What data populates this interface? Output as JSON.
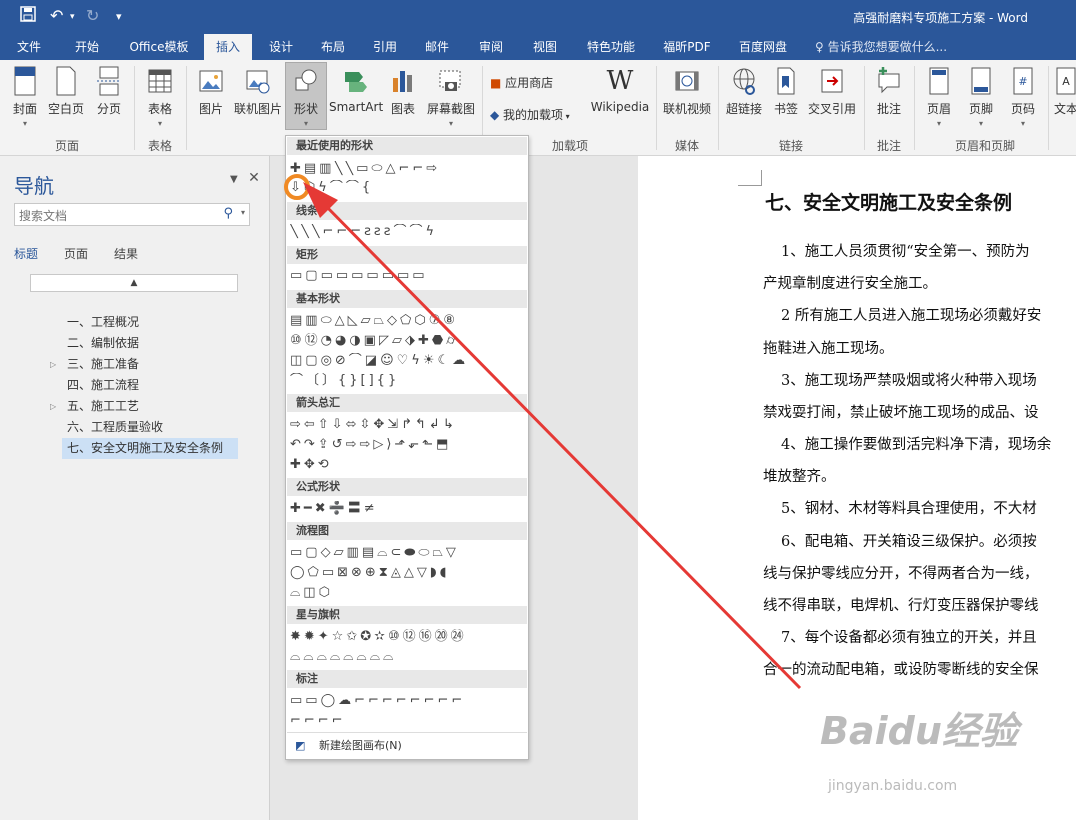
{
  "quick_access": {
    "save_icon": "save-icon",
    "undo_icon": "undo-icon",
    "redo_icon": "redo-icon",
    "customize_icon": "customize-icon"
  },
  "window": {
    "title": "高强耐磨料专项施工方案 - Word"
  },
  "tabs": [
    "文件",
    "开始",
    "Office模板",
    "插入",
    "设计",
    "布局",
    "引用",
    "邮件",
    "审阅",
    "视图",
    "特色功能",
    "福昕PDF",
    "百度网盘"
  ],
  "tell_me": "告诉我您想要做什么...",
  "ribbon": {
    "pages": {
      "cover": "封面",
      "blank": "空白页",
      "break": "分页",
      "group": "页面"
    },
    "tables": {
      "table": "表格",
      "group": "表格"
    },
    "illustrations": {
      "picture": "图片",
      "online_picture": "联机图片",
      "shapes": "形状",
      "smartart": "SmartArt",
      "chart": "图表",
      "screenshot": "屏幕截图"
    },
    "addins": {
      "store": "应用商店",
      "my_addins": "我的加载项",
      "wikipedia": "Wikipedia",
      "group": "加载项"
    },
    "media": {
      "online_video": "联机视频",
      "group": "媒体"
    },
    "links": {
      "hyperlink": "超链接",
      "bookmark": "书签",
      "cross_ref": "交叉引用",
      "group": "链接"
    },
    "comments": {
      "comment": "批注",
      "group": "批注"
    },
    "header_footer": {
      "header": "页眉",
      "footer": "页脚",
      "page_number": "页码",
      "group": "页眉和页脚"
    },
    "text": {
      "textbox": "文本"
    }
  },
  "nav": {
    "title": "导航",
    "search_placeholder": "搜索文档",
    "tabs": [
      "标题",
      "页面",
      "结果"
    ],
    "items": [
      "一、工程概况",
      "二、编制依据",
      "三、施工准备",
      "四、施工流程",
      "五、施工工艺",
      "六、工程质量验收",
      "七、安全文明施工及安全条例"
    ]
  },
  "gallery": {
    "sections": [
      "最近使用的形状",
      "线条",
      "矩形",
      "基本形状",
      "箭头总汇",
      "公式形状",
      "流程图",
      "星与旗帜",
      "标注"
    ],
    "recent_row1": "✚▤▥╲╲▭⬭△⌐⌐⇨",
    "recent_row2": "⇩⬡ϟ⌒⌒{",
    "lines_row": "╲╲╲⌐⌐⌐ƨƨƨ⌒⌒ϟ",
    "rect_row": "▭▢▭▭▭▭▭▭▭",
    "basic_rows": [
      "▤▥⬭△◺▱⏢◇⬠⬡⑦⑧",
      "⑩⑫◔◕◑▣◸▱⬗✚⬣⌭",
      "◫▢◎⊘⌒◪☺♡ϟ☀☾☁",
      "⌒〔〕{}[]{}"
    ],
    "arrow_rows": [
      "⇨⇦⇧⇩⬄⇳✥⇲↱↰↲↳",
      "↶↷⇪↺⇨⇨▷⟩⬏⬐⬑⬒",
      "✚✥⟲"
    ],
    "equation_row": "✚━✖➗〓≠",
    "flow_rows": [
      "▭▢◇▱▥▤⌓⊂⬬⬭⏢▽",
      "◯⬠▭⊠⊗⊕⧗◬△▽◗◖",
      "⌓◫⬡"
    ],
    "star_rows": [
      "✸✹✦☆✩✪✫⑩⑫⑯⑳㉔",
      "⌓⌓⌓⌓⌓⌓⌓⌓"
    ],
    "callout_rows": [
      "▭▭◯☁⌐⌐⌐⌐⌐⌐⌐⌐",
      "⌐⌐⌐⌐"
    ],
    "new_canvas": "新建绘图画布(N)"
  },
  "document": {
    "heading": "七、安全文明施工及安全条例",
    "lines": [
      "1、施工人员须贯彻“安全第一、预防为",
      "产规章制度进行安全施工。",
      "2 所有施工人员进入施工现场必须戴好安",
      "拖鞋进入施工现场。",
      "3、施工现场严禁吸烟或将火种带入现场",
      "禁戏耍打闹，禁止破坏施工现场的成品、设",
      "4、施工操作要做到活完料净下清，现场余",
      "堆放整齐。",
      "5、钢材、木材等料具合理使用，不大材",
      "6、配电箱、开关箱设三级保护。必须按",
      "线与保护零线应分开，不得两者合为一线，",
      "线不得串联，电焊机、行灯变压器保护零线",
      "7、每个设备都必须有独立的开关，并且",
      "合一的流动配电箱，或设防零断线的安全保"
    ]
  },
  "watermark": {
    "logo": "Baidu经验",
    "url": "jingyan.baidu.com"
  },
  "colors": {
    "titlebar": "#2b579a",
    "annotation_arrow": "#e53935",
    "highlight_circle": "#f08a24"
  }
}
